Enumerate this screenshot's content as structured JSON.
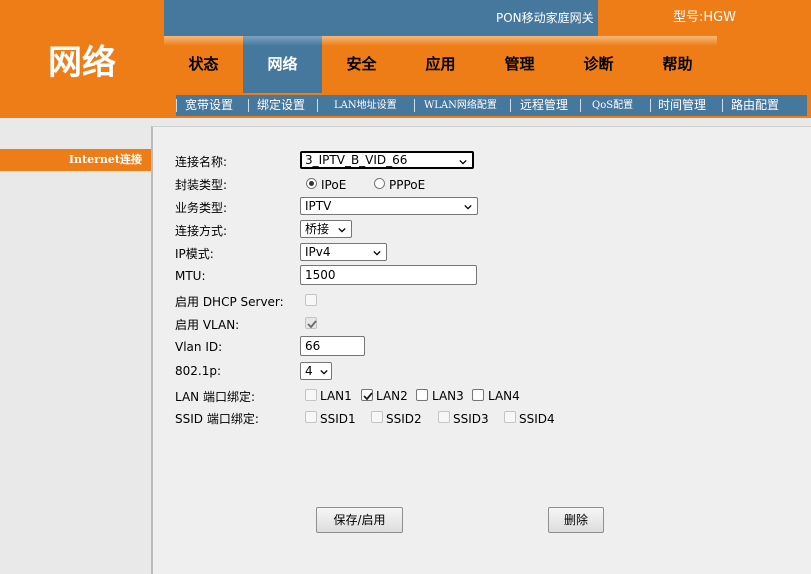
{
  "header": {
    "logo_text": "网络",
    "device_title": "PON移动家庭网关",
    "model_label": "型号:HGW"
  },
  "main_nav": {
    "tabs": [
      {
        "label": "状态"
      },
      {
        "label": "网络"
      },
      {
        "label": "安全"
      },
      {
        "label": "应用"
      },
      {
        "label": "管理"
      },
      {
        "label": "诊断"
      },
      {
        "label": "帮助"
      }
    ],
    "active": "网络"
  },
  "sub_nav": {
    "items": [
      {
        "label": "宽带设置"
      },
      {
        "label": "绑定设置"
      },
      {
        "label": "LAN地址设置"
      },
      {
        "label": "WLAN网络配置"
      },
      {
        "label": "远程管理"
      },
      {
        "label": "QoS配置"
      },
      {
        "label": "时间管理"
      },
      {
        "label": "路由配置"
      }
    ]
  },
  "sidebar": {
    "items": [
      {
        "label": "Internet连接"
      }
    ]
  },
  "form": {
    "connection_name": {
      "label": "连接名称:",
      "value": "3_IPTV_B_VID_66"
    },
    "encap_type": {
      "label": "封装类型:",
      "options": [
        "IPoE",
        "PPPoE"
      ],
      "selected": "IPoE"
    },
    "service_type": {
      "label": "业务类型:",
      "value": "IPTV"
    },
    "connection_mode": {
      "label": "连接方式:",
      "value": "桥接"
    },
    "ip_mode": {
      "label": "IP模式:",
      "value": "IPv4"
    },
    "mtu": {
      "label": "MTU:",
      "value": "1500"
    },
    "dhcp_server": {
      "label": "启用 DHCP Server:",
      "checked": false,
      "disabled": true
    },
    "vlan_enable": {
      "label": "启用 VLAN:",
      "checked": true,
      "disabled": true
    },
    "vlan_id": {
      "label": "Vlan ID:",
      "value": "66"
    },
    "priority": {
      "label": "802.1p:",
      "value": "4"
    },
    "lan_binding": {
      "label": "LAN 端口绑定:",
      "ports": [
        {
          "label": "LAN1",
          "checked": false,
          "disabled": true
        },
        {
          "label": "LAN2",
          "checked": true,
          "disabled": false
        },
        {
          "label": "LAN3",
          "checked": false,
          "disabled": false
        },
        {
          "label": "LAN4",
          "checked": false,
          "disabled": false
        }
      ]
    },
    "ssid_binding": {
      "label": "SSID 端口绑定:",
      "ports": [
        {
          "label": "SSID1",
          "checked": false,
          "disabled": true
        },
        {
          "label": "SSID2",
          "checked": false,
          "disabled": true
        },
        {
          "label": "SSID3",
          "checked": false,
          "disabled": true
        },
        {
          "label": "SSID4",
          "checked": false,
          "disabled": true
        }
      ]
    }
  },
  "actions": {
    "save_label": "保存/启用",
    "delete_label": "删除"
  },
  "colors": {
    "brand_orange": "#ee7d17",
    "nav_blue": "#46779c"
  }
}
